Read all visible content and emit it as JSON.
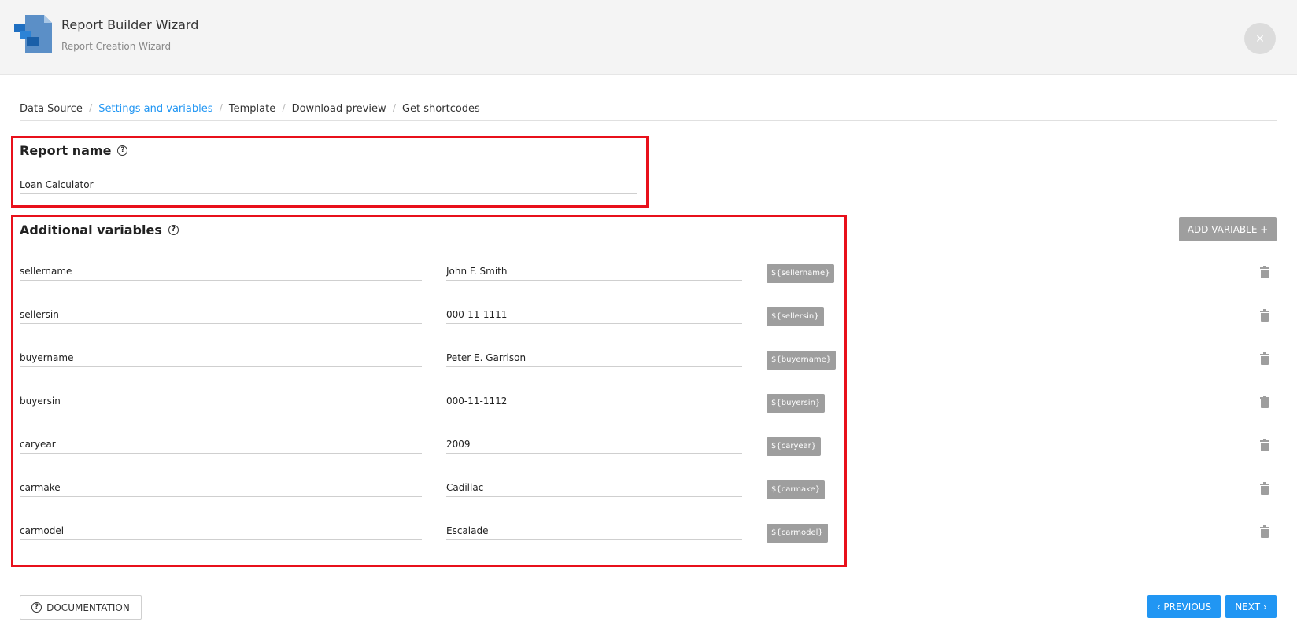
{
  "header": {
    "title": "Report Builder Wizard",
    "subtitle": "Report Creation Wizard",
    "close_icon": "×"
  },
  "breadcrumb": [
    {
      "label": "Data Source",
      "active": false
    },
    {
      "label": "Settings and variables",
      "active": true
    },
    {
      "label": "Template",
      "active": false
    },
    {
      "label": "Download preview",
      "active": false
    },
    {
      "label": "Get shortcodes",
      "active": false
    }
  ],
  "breadcrumb_separator": "/",
  "report_name": {
    "title": "Report name",
    "value": "Loan Calculator"
  },
  "variables": {
    "title": "Additional variables",
    "add_button": "ADD VARIABLE +",
    "items": [
      {
        "name": "sellername",
        "value": "John F. Smith",
        "tag": "${sellername}"
      },
      {
        "name": "sellersin",
        "value": "000-11-1111",
        "tag": "${sellersin}"
      },
      {
        "name": "buyername",
        "value": "Peter E. Garrison",
        "tag": "${buyername}"
      },
      {
        "name": "buyersin",
        "value": "000-11-1112",
        "tag": "${buyersin}"
      },
      {
        "name": "caryear",
        "value": "2009",
        "tag": "${caryear}"
      },
      {
        "name": "carmake",
        "value": "Cadillac",
        "tag": "${carmake}"
      },
      {
        "name": "carmodel",
        "value": "Escalade",
        "tag": "${carmodel}"
      }
    ]
  },
  "footer": {
    "documentation": "DOCUMENTATION",
    "previous": "‹ PREVIOUS",
    "next": "NEXT ›"
  },
  "colors": {
    "accent": "#2196f3",
    "highlight_border": "#e8101b",
    "tag_bg": "#9e9e9e"
  },
  "icons": {
    "help": "?",
    "trash": "trash-icon",
    "logo": "report-builder-logo"
  }
}
